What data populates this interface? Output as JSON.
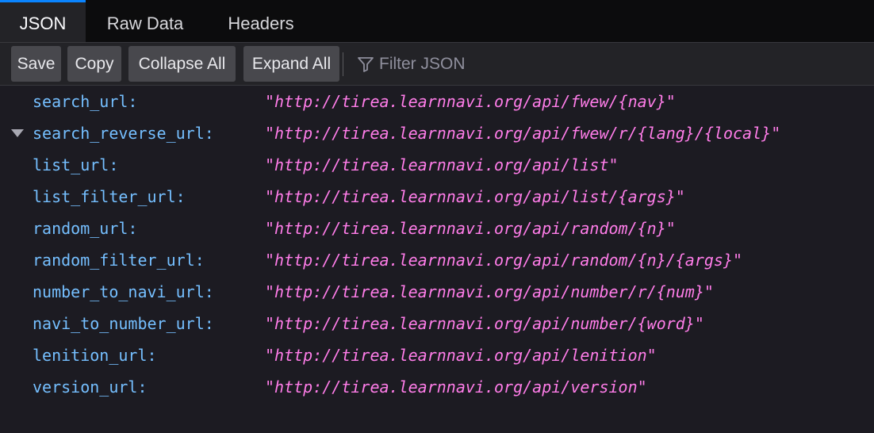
{
  "tabs": [
    {
      "label": "JSON",
      "active": true
    },
    {
      "label": "Raw Data",
      "active": false
    },
    {
      "label": "Headers",
      "active": false
    }
  ],
  "toolbar": {
    "save_label": "Save",
    "copy_label": "Copy",
    "collapse_label": "Collapse All",
    "expand_label": "Expand All",
    "filter_placeholder": "Filter JSON",
    "filter_icon": "funnel-icon"
  },
  "colors": {
    "key": "#75bfff",
    "string": "#ff7de9",
    "accent": "#0a84ff"
  },
  "rows": [
    {
      "key": "search_url:",
      "value": "http://tirea.learnnavi.org/api/fwew/{nav}",
      "twisty": false
    },
    {
      "key": "search_reverse_url:",
      "value": "http://tirea.learnnavi.org/api/fwew/r/{lang}/{local}",
      "twisty": true
    },
    {
      "key": "list_url:",
      "value": "http://tirea.learnnavi.org/api/list",
      "twisty": false
    },
    {
      "key": "list_filter_url:",
      "value": "http://tirea.learnnavi.org/api/list/{args}",
      "twisty": false
    },
    {
      "key": "random_url:",
      "value": "http://tirea.learnnavi.org/api/random/{n}",
      "twisty": false
    },
    {
      "key": "random_filter_url:",
      "value": "http://tirea.learnnavi.org/api/random/{n}/{args}",
      "twisty": false
    },
    {
      "key": "number_to_navi_url:",
      "value": "http://tirea.learnnavi.org/api/number/r/{num}",
      "twisty": false
    },
    {
      "key": "navi_to_number_url:",
      "value": "http://tirea.learnnavi.org/api/number/{word}",
      "twisty": false
    },
    {
      "key": "lenition_url:",
      "value": "http://tirea.learnnavi.org/api/lenition",
      "twisty": false
    },
    {
      "key": "version_url:",
      "value": "http://tirea.learnnavi.org/api/version",
      "twisty": false
    }
  ]
}
